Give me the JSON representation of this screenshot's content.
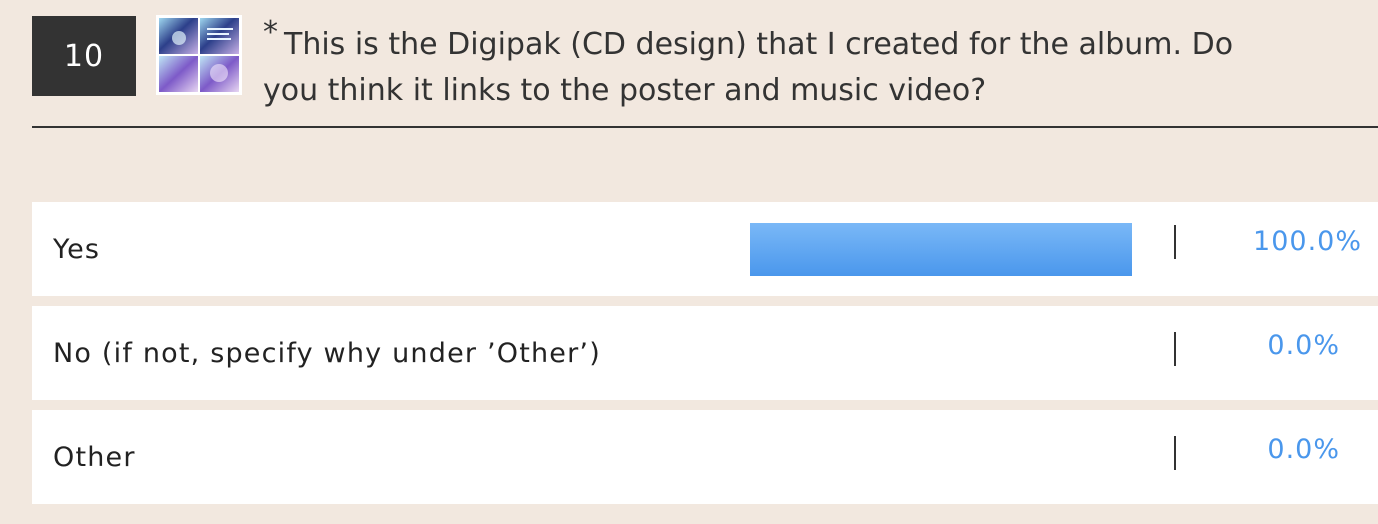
{
  "question": {
    "number": "10",
    "required_marker": "*",
    "text": "This is the Digipak (CD design) that I created for the album. Do you think it links to the poster and music video?",
    "thumbnail": "digipak-thumbnail"
  },
  "results": [
    {
      "label": "Yes",
      "percent_text": "100.0%",
      "fraction": 1.0
    },
    {
      "label": "No (if not, specify why under ’Other’)",
      "percent_text": "0.0%",
      "fraction": 0.0
    },
    {
      "label": "Other",
      "percent_text": "0.0%",
      "fraction": 0.0
    }
  ],
  "colors": {
    "background": "#f2e8df",
    "bar": "#4a97ec",
    "percent_text": "#4a97ec",
    "number_badge": "#333333"
  }
}
